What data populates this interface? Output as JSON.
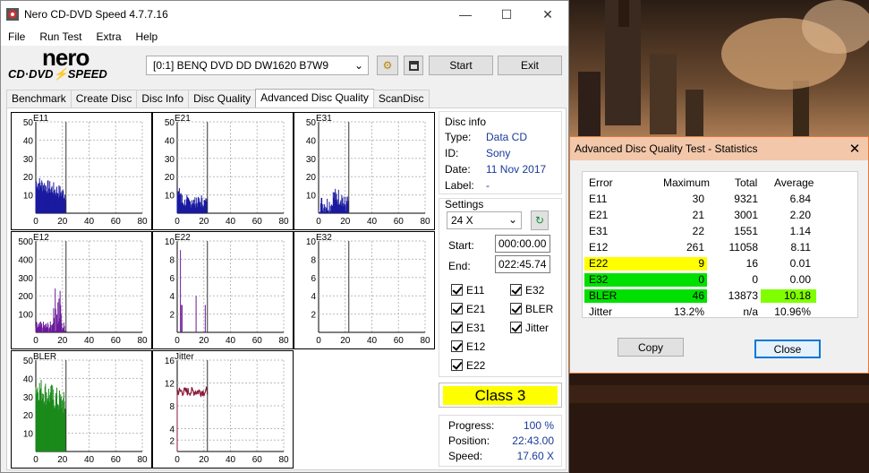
{
  "app": {
    "title": "Nero CD-DVD Speed 4.7.7.16",
    "menu": [
      "File",
      "Run Test",
      "Extra",
      "Help"
    ],
    "logo_top": "nero",
    "logo_bottom": "CD·DVD⚡SPEED"
  },
  "toolbar": {
    "drive": "[0:1]   BENQ DVD DD DW1620 B7W9",
    "start": "Start",
    "exit": "Exit"
  },
  "tabs": [
    "Benchmark",
    "Create Disc",
    "Disc Info",
    "Disc Quality",
    "Advanced Disc Quality",
    "ScanDisc"
  ],
  "discinfo": {
    "title": "Disc info",
    "type_label": "Type:",
    "type": "Data CD",
    "id_label": "ID:",
    "id": "Sony",
    "date_label": "Date:",
    "date": "11 Nov 2017",
    "label_label": "Label:",
    "label": "-"
  },
  "settings": {
    "title": "Settings",
    "speed": "24 X",
    "start_label": "Start:",
    "start": "000:00.00",
    "end_label": "End:",
    "end": "022:45.74",
    "checks": [
      "E11",
      "E32",
      "E21",
      "BLER",
      "E31",
      "Jitter",
      "E12",
      "E22"
    ]
  },
  "class_label": "Class 3",
  "progress": {
    "progress_label": "Progress:",
    "progress": "100 %",
    "position_label": "Position:",
    "position": "22:43.00",
    "speed_label": "Speed:",
    "speed": "17.60 X"
  },
  "charts": {
    "e11": "E11",
    "e21": "E21",
    "e31": "E31",
    "e12": "E12",
    "e22": "E22",
    "e32": "E32",
    "bler": "BLER",
    "jitter": "Jitter"
  },
  "chart_data": [
    {
      "type": "bar",
      "title": "E11",
      "ylim": [
        0,
        50
      ],
      "yticks": [
        10,
        20,
        30,
        40,
        50
      ],
      "xticks": [
        0,
        20,
        40,
        60,
        80
      ],
      "color": "#1a1aa0"
    },
    {
      "type": "bar",
      "title": "E21",
      "ylim": [
        0,
        50
      ],
      "yticks": [
        10,
        20,
        30,
        40,
        50
      ],
      "xticks": [
        0,
        20,
        40,
        60,
        80
      ],
      "color": "#1a1aa0"
    },
    {
      "type": "bar",
      "title": "E31",
      "ylim": [
        0,
        50
      ],
      "yticks": [
        10,
        20,
        30,
        40,
        50
      ],
      "xticks": [
        0,
        20,
        40,
        60,
        80
      ],
      "color": "#1a1aa0"
    },
    {
      "type": "bar",
      "title": "E12",
      "ylim": [
        0,
        500
      ],
      "yticks": [
        100,
        200,
        300,
        400,
        500
      ],
      "xticks": [
        0,
        20,
        40,
        60,
        80
      ],
      "color": "#6a1a9a"
    },
    {
      "type": "bar",
      "title": "E22",
      "ylim": [
        0,
        10
      ],
      "yticks": [
        2,
        4,
        6,
        8,
        10
      ],
      "xticks": [
        0,
        20,
        40,
        60,
        80
      ],
      "color": "#6a1a9a"
    },
    {
      "type": "bar",
      "title": "E32",
      "ylim": [
        0,
        10
      ],
      "yticks": [
        2,
        4,
        6,
        8,
        10
      ],
      "xticks": [
        0,
        20,
        40,
        60,
        80
      ],
      "color": "#6a1a9a"
    },
    {
      "type": "bar",
      "title": "BLER",
      "ylim": [
        0,
        50
      ],
      "yticks": [
        10,
        20,
        30,
        40,
        50
      ],
      "xticks": [
        0,
        20,
        40,
        60,
        80
      ],
      "color": "#1a8a1a"
    },
    {
      "type": "line",
      "title": "Jitter",
      "ylim": [
        0,
        16
      ],
      "yticks": [
        2,
        4,
        8,
        12,
        16
      ],
      "xticks": [
        0,
        20,
        40,
        60,
        80
      ],
      "color": "#8a1a3a"
    }
  ],
  "stats": {
    "title": "Advanced Disc Quality Test - Statistics",
    "headers": [
      "Error",
      "Maximum",
      "Total",
      "Average"
    ],
    "rows": [
      [
        "E11",
        "30",
        "9321",
        "6.84"
      ],
      [
        "E21",
        "21",
        "3001",
        "2.20"
      ],
      [
        "E31",
        "22",
        "1551",
        "1.14"
      ],
      [
        "E12",
        "261",
        "11058",
        "8.11"
      ],
      [
        "E22",
        "9",
        "16",
        "0.01"
      ],
      [
        "E32",
        "0",
        "0",
        "0.00"
      ],
      [
        "BLER",
        "46",
        "13873",
        "10.18"
      ],
      [
        "Jitter",
        "13.2%",
        "n/a",
        "10.96%"
      ]
    ],
    "copy": "Copy",
    "close": "Close"
  }
}
